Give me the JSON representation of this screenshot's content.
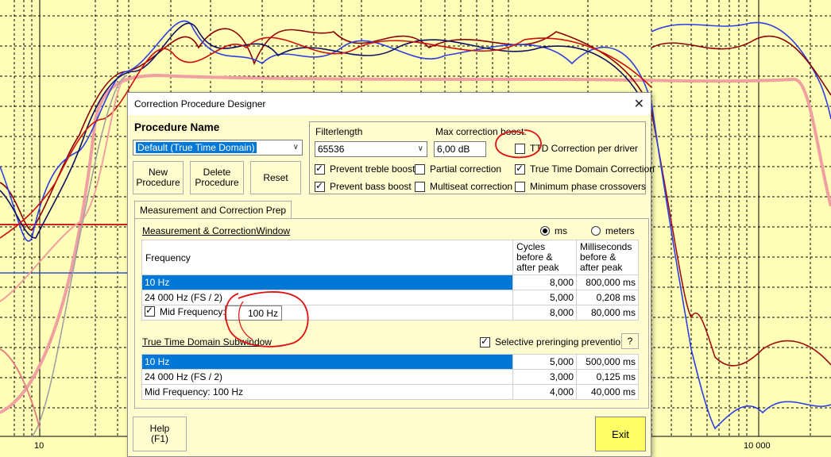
{
  "background": {
    "x_tick_labels": [
      "10",
      "10 000"
    ]
  },
  "dialog": {
    "title": "Correction Procedure Designer",
    "procedure_name_label": "Procedure Name",
    "procedure_select_value": "Default (True Time Domain)",
    "buttons": {
      "new": "New\nProcedure",
      "delete": "Delete\nProcedure",
      "reset": "Reset",
      "help": "Help\n(F1)",
      "exit": "Exit",
      "question": "?"
    },
    "filter": {
      "filterlength_label": "Filterlength",
      "filterlength_value": "65536",
      "max_boost_label": "Max correction boost:",
      "max_boost_value": "6,00 dB"
    },
    "options": {
      "ttd_per_driver": {
        "label": "TTD Correction per driver",
        "checked": false
      },
      "prevent_treble": {
        "label": "Prevent treble boost",
        "checked": true
      },
      "partial": {
        "label": "Partial correction",
        "checked": false
      },
      "true_time_domain": {
        "label": "True Time Domain Correction",
        "checked": true
      },
      "prevent_bass": {
        "label": "Prevent bass boost",
        "checked": true
      },
      "multiseat": {
        "label": "Multiseat correction",
        "checked": false
      },
      "min_phase": {
        "label": "Minimum phase crossovers",
        "checked": false
      }
    },
    "tab_label": "Measurement and Correction Prep",
    "measurement": {
      "title": "Measurement & CorrectionWindow",
      "radio_ms": "ms",
      "radio_meters": "meters",
      "headers": {
        "frequency": "Frequency",
        "cycles": "Cycles before & after peak",
        "ms": "Milliseconds before & after peak"
      },
      "rows": [
        {
          "freq": "10 Hz",
          "cycles": "8,000",
          "ms": "800,000 ms"
        },
        {
          "freq": "24 000 Hz (FS / 2)",
          "cycles": "5,000",
          "ms": "0,208 ms"
        }
      ],
      "mid": {
        "label": "Mid Frequency:",
        "value": "100 Hz",
        "cycles": "8,000",
        "ms": "80,000 ms"
      }
    },
    "ttd": {
      "title": "True Time Domain Subwindow",
      "preringing_label": "Selective preringing prevention",
      "rows": [
        {
          "freq": "10 Hz",
          "cycles": "5,000",
          "ms": "500,000 ms"
        },
        {
          "freq": "24 000 Hz (FS / 2)",
          "cycles": "3,000",
          "ms": "0,125 ms"
        },
        {
          "freq": "Mid Frequency: 100 Hz",
          "cycles": "4,000",
          "ms": "40,000 ms"
        }
      ]
    }
  },
  "colors": {
    "plot_bg": "#ffffb8",
    "dialog_bg": "#fffccf",
    "selection": "#0078d7",
    "exit_button": "#ffff66",
    "annotation_red": "#e01010"
  }
}
